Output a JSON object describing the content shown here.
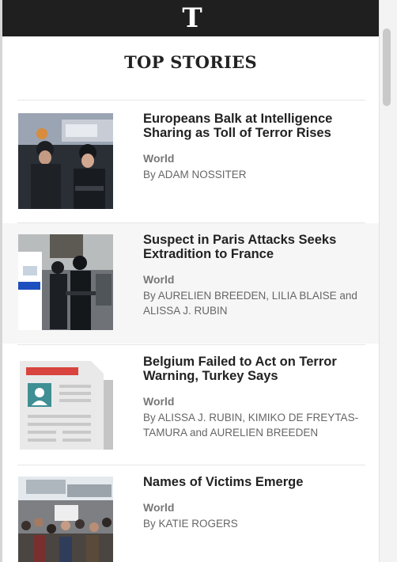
{
  "brand": {
    "logo_text": "T"
  },
  "page": {
    "title": "TOP STORIES"
  },
  "stories": [
    {
      "headline": "Europeans Balk at Intelligence Sharing as Toll of Terror Rises",
      "section": "World",
      "byline": "By ADAM NOSSITER",
      "image": "police-officers-photo"
    },
    {
      "headline": "Suspect in Paris Attacks Seeks Extradition to France",
      "section": "World",
      "byline": "By AURELIEN BREEDEN, LILIA BLAISE and ALISSA J. RUBIN",
      "image": "armed-police-van-photo"
    },
    {
      "headline": "Belgium Failed to Act on Terror Warning, Turkey Says",
      "section": "World",
      "byline": "By ALISSA J. RUBIN, KIMIKO DE FREYTAS-TAMURA and AURELIEN BREEDEN",
      "image": "newspaper-placeholder-icon"
    },
    {
      "headline": "Names of Victims Emerge",
      "section": "World",
      "byline": "By KATIE ROGERS",
      "image": "crowd-evacuation-photo"
    }
  ],
  "colors": {
    "topbar": "#1f1f1f",
    "alt_row": "#f6f6f6",
    "section_text": "#777777",
    "placeholder_red": "#d9443f",
    "placeholder_teal": "#3f8f94"
  }
}
